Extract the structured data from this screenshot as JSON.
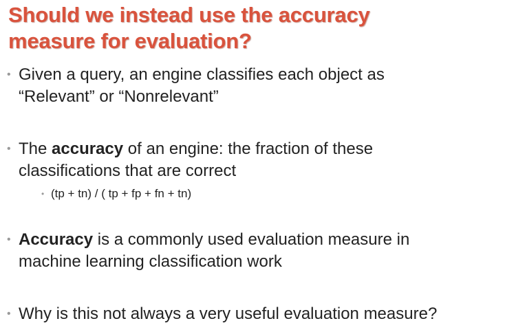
{
  "title": {
    "line1": "Should we instead use the accuracy",
    "line2": "measure for evaluation?"
  },
  "bullet_marker": "•",
  "bullets": [
    {
      "line1": "Given a query, an engine classifies each object as",
      "line2": "“Relevant” or “Nonrelevant”"
    },
    {
      "pre": "The ",
      "bold": "accuracy",
      "post": " of an engine: the fraction of these",
      "line2": "classifications that are correct",
      "sub": "(tp + tn) / ( tp + fp + fn + tn)"
    },
    {
      "bold": "Accuracy",
      "post": " is a commonly used evaluation measure in",
      "line2": "machine learning classification work"
    },
    {
      "line1": "Why is this not always a very useful evaluation measure?"
    }
  ],
  "colors": {
    "title": "#d9533d",
    "text": "#222222",
    "bullet_marker": "#9a9a9a"
  }
}
